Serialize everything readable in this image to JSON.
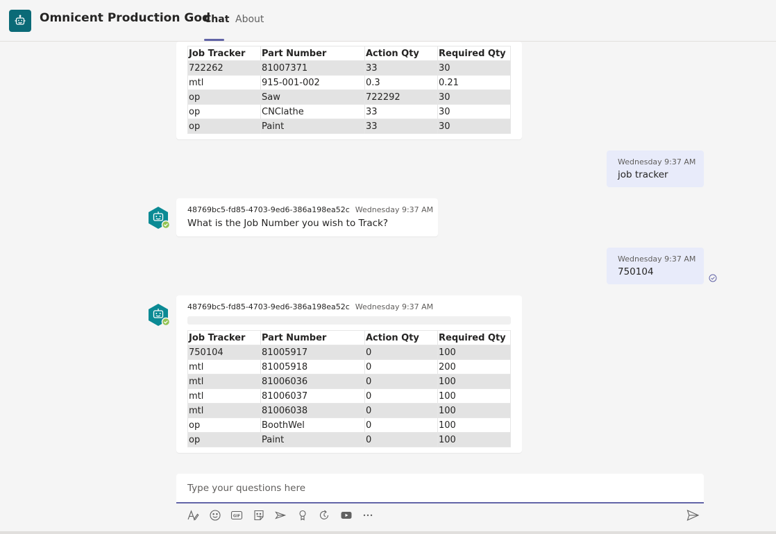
{
  "header": {
    "app_title": "Omnicent Production God",
    "tabs": [
      {
        "label": "Chat",
        "active": true
      },
      {
        "label": "About",
        "active": false
      }
    ]
  },
  "colors": {
    "accent": "#6264a7",
    "bot_avatar": "#0b6a77",
    "status_online": "#92c353",
    "user_bubble": "#e8ebfa"
  },
  "messages": [
    {
      "role": "bot",
      "table": {
        "headers": [
          "Job Tracker",
          "Part Number",
          "Action Qty",
          "Required Qty"
        ],
        "rows": [
          [
            "722262",
            "81007371",
            "33",
            "30"
          ],
          [
            "mtl",
            "915-001-002",
            "0.3",
            "0.21"
          ],
          [
            "op",
            "Saw",
            "722292",
            "30"
          ],
          [
            "op",
            "CNClathe",
            "33",
            "30"
          ],
          [
            "op",
            "Paint",
            "33",
            "30"
          ]
        ]
      }
    },
    {
      "role": "user",
      "time": "Wednesday 9:37 AM",
      "text": "job tracker"
    },
    {
      "role": "bot",
      "sender": "48769bc5-fd85-4703-9ed6-386a198ea52c",
      "time": "Wednesday 9:37 AM",
      "text": "What is the Job Number you wish to Track?"
    },
    {
      "role": "user",
      "time": "Wednesday 9:37 AM",
      "text": "750104"
    },
    {
      "role": "bot",
      "sender": "48769bc5-fd85-4703-9ed6-386a198ea52c",
      "time": "Wednesday 9:37 AM",
      "table": {
        "headers": [
          "Job Tracker",
          "Part Number",
          "Action Qty",
          "Required Qty"
        ],
        "rows": [
          [
            "750104",
            "81005917",
            "0",
            "100"
          ],
          [
            "mtl",
            "81005918",
            "0",
            "200"
          ],
          [
            "mtl",
            "81006036",
            "0",
            "100"
          ],
          [
            "mtl",
            "81006037",
            "0",
            "100"
          ],
          [
            "mtl",
            "81006038",
            "0",
            "100"
          ],
          [
            "op",
            "BoothWel",
            "0",
            "100"
          ],
          [
            "op",
            "Paint",
            "0",
            "100"
          ]
        ]
      }
    }
  ],
  "compose": {
    "placeholder": "Type your questions here",
    "toolbar": [
      "format-icon",
      "emoji-icon",
      "gif-icon",
      "sticker-icon",
      "meet-now-icon",
      "praise-icon",
      "loop-icon",
      "stream-icon",
      "more-options-icon"
    ],
    "send_icon": "send-icon"
  }
}
